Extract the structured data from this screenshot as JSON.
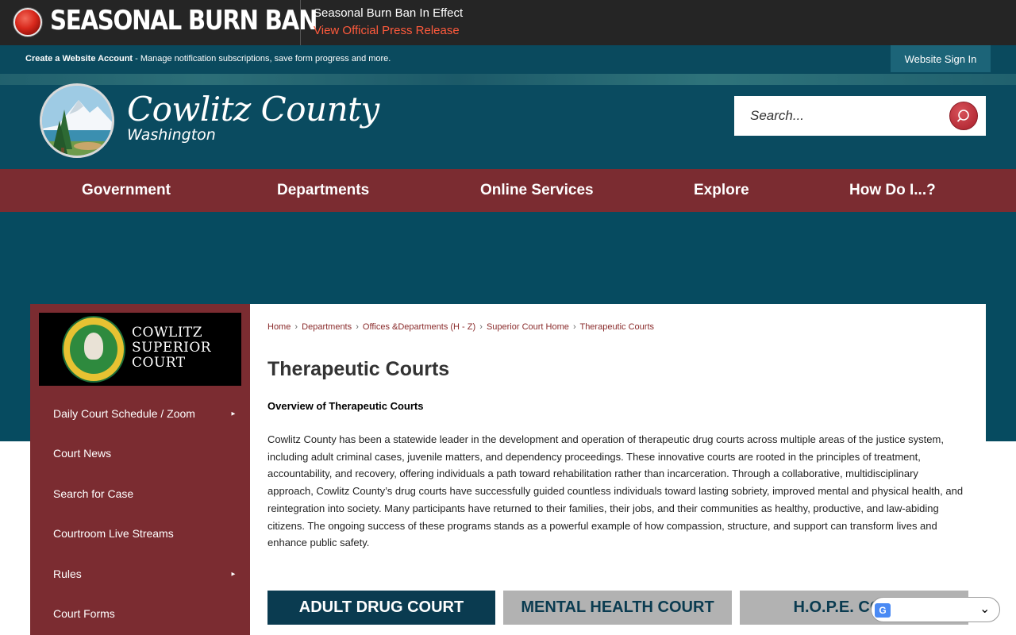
{
  "alert": {
    "title": "SEASONAL BURN BAN",
    "heading": "Seasonal Burn Ban In Effect",
    "link_label": "View Official Press Release",
    "icon": "alert-beacon-icon"
  },
  "account_bar": {
    "create_label": "Create a Website Account",
    "description": " - Manage notification subscriptions, save form progress and more.",
    "sign_in_label": "Website Sign In"
  },
  "header": {
    "logo_name": "Cowlitz County",
    "logo_sub": "Washington",
    "search_placeholder": "Search...",
    "search_icon": "search-icon"
  },
  "nav": {
    "items": [
      "Government",
      "Departments",
      "Online Services",
      "Explore",
      "How Do I...?"
    ]
  },
  "sidebar": {
    "court_logo_text": [
      "COWLITZ",
      "SUPERIOR",
      "COURT"
    ],
    "items": [
      {
        "label": "Daily Court Schedule / Zoom",
        "has_submenu": true
      },
      {
        "label": "Court News",
        "has_submenu": false
      },
      {
        "label": "Search for Case",
        "has_submenu": false
      },
      {
        "label": "Courtroom Live Streams",
        "has_submenu": false
      },
      {
        "label": "Rules",
        "has_submenu": true
      },
      {
        "label": "Court Forms",
        "has_submenu": false
      }
    ],
    "submenu_arrow": "►"
  },
  "breadcrumb": [
    "Home",
    "Departments",
    "Offices &Departments (H - Z)",
    "Superior Court Home",
    "Therapeutic Courts"
  ],
  "breadcrumb_separator": "›",
  "content": {
    "title": "Therapeutic Courts",
    "overview_heading": "Overview of Therapeutic Courts",
    "overview_body": " Cowlitz County has been a statewide leader in the development and operation of therapeutic drug courts across multiple areas of the justice system, including adult criminal cases, juvenile matters, and dependency proceedings. These innovative courts are rooted in the principles of treatment, accountability, and recovery, offering individuals a path toward rehabilitation rather than incarceration. Through a collaborative, multidisciplinary approach, Cowlitz County’s drug courts have successfully guided countless individuals toward lasting sobriety, improved mental and physical health, and reintegration into society. Many participants have returned to their families, their jobs, and their communities as healthy, productive, and law-abiding citizens. The ongoing success of these programs stands as a powerful example of how compassion, structure, and support can transform lives and enhance public safety.",
    "court_buttons": [
      "ADULT DRUG COURT",
      "MENTAL HEALTH COURT",
      "H.O.P.E. COURT"
    ]
  },
  "translate": {
    "icon": "google-translate-icon",
    "chevron": "⌄"
  },
  "colors": {
    "alert_bg": "#252525",
    "alert_link": "#ff5a3c",
    "teal": "#0a4b60",
    "maroon": "#7b2c31",
    "button_dark": "#0a3b50",
    "button_grey": "#b2b2b2"
  }
}
